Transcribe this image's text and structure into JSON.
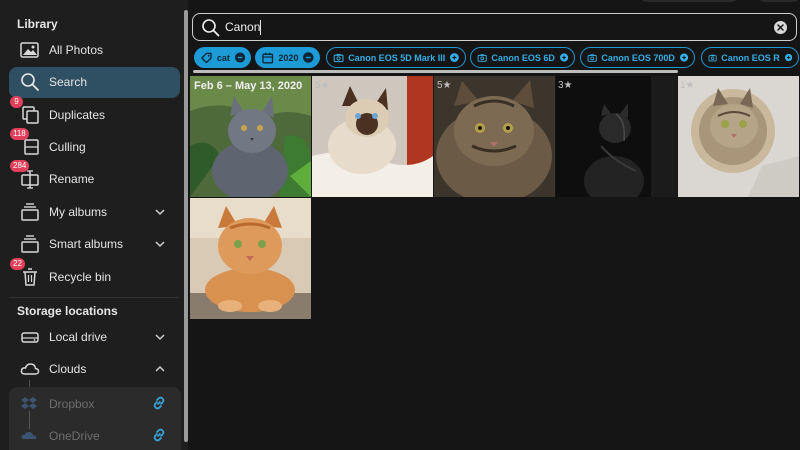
{
  "sidebar": {
    "library_heading": "Library",
    "storage_heading": "Storage locations",
    "items": [
      {
        "label": "All Photos",
        "icon": "photo-icon",
        "badge": null
      },
      {
        "label": "Search",
        "icon": "search-icon",
        "badge": null,
        "active": true
      },
      {
        "label": "Duplicates",
        "icon": "duplicates-icon",
        "badge": "9"
      },
      {
        "label": "Culling",
        "icon": "culling-icon",
        "badge": "118"
      },
      {
        "label": "Rename",
        "icon": "rename-icon",
        "badge": "284"
      },
      {
        "label": "My albums",
        "icon": "album-icon",
        "badge": null
      },
      {
        "label": "Smart albums",
        "icon": "smart-album-icon",
        "badge": null
      },
      {
        "label": "Recycle bin",
        "icon": "trash-icon",
        "badge": "22"
      }
    ],
    "storage": [
      {
        "label": "Local drive",
        "icon": "drive-icon"
      },
      {
        "label": "Clouds",
        "icon": "cloud-icon"
      }
    ],
    "clouds": [
      {
        "label": "Dropbox",
        "icon": "dropbox-icon"
      },
      {
        "label": "OneDrive",
        "icon": "onedrive-icon"
      }
    ]
  },
  "search": {
    "query": "Canon",
    "placeholder": ""
  },
  "filters": [
    {
      "label": "cat",
      "type": "tag",
      "style": "filled"
    },
    {
      "label": "2020",
      "type": "date",
      "style": "filled"
    },
    {
      "label": "Canon EOS 5D Mark III",
      "type": "camera",
      "style": "outline"
    },
    {
      "label": "Canon EOS 6D",
      "type": "camera",
      "style": "outline"
    },
    {
      "label": "Canon EOS 700D",
      "type": "camera",
      "style": "outline"
    },
    {
      "label": "Canon EOS R",
      "type": "camera",
      "style": "outline"
    }
  ],
  "results": {
    "date_range": "Feb 6 – May 13, 2020",
    "ratings": [
      "5★",
      "5★",
      "3★",
      "1★"
    ]
  },
  "colors": {
    "accent": "#1d9bd6",
    "active_bg": "#2f4f63",
    "badge": "#e0405a",
    "link": "#3aa9e0"
  }
}
